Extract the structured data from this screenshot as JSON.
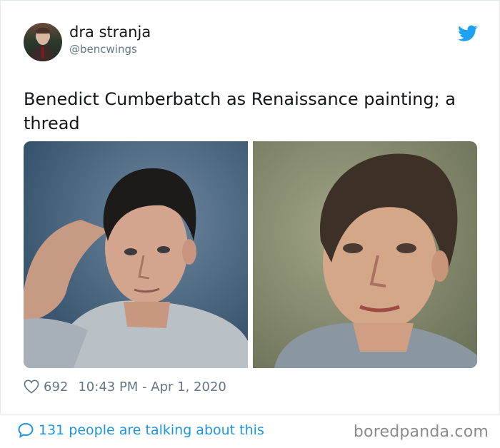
{
  "user": {
    "display_name": "dra stranja",
    "handle": "@bencwings",
    "avatar_icon": "profile-photo-man-suit"
  },
  "tweet": {
    "text": "Benedict Cumberbatch as Renaissance painting; a thread",
    "images": [
      {
        "name": "photo-of-man-grey-tshirt",
        "background": "#4b6a86"
      },
      {
        "name": "renaissance-style-painting-portrait",
        "background": "#8c9170"
      }
    ]
  },
  "meta": {
    "heart_icon": "heart-outline-icon",
    "likes": "692",
    "timestamp": "10:43 PM - Apr 1, 2020"
  },
  "footer": {
    "bubble_icon": "speech-bubble-icon",
    "talking": "131 people are talking about this",
    "watermark": "boredpanda.com"
  },
  "colors": {
    "twitter_blue": "#1b95e0",
    "muted": "#657786",
    "text": "#14171a",
    "border": "#e1e8ed"
  }
}
